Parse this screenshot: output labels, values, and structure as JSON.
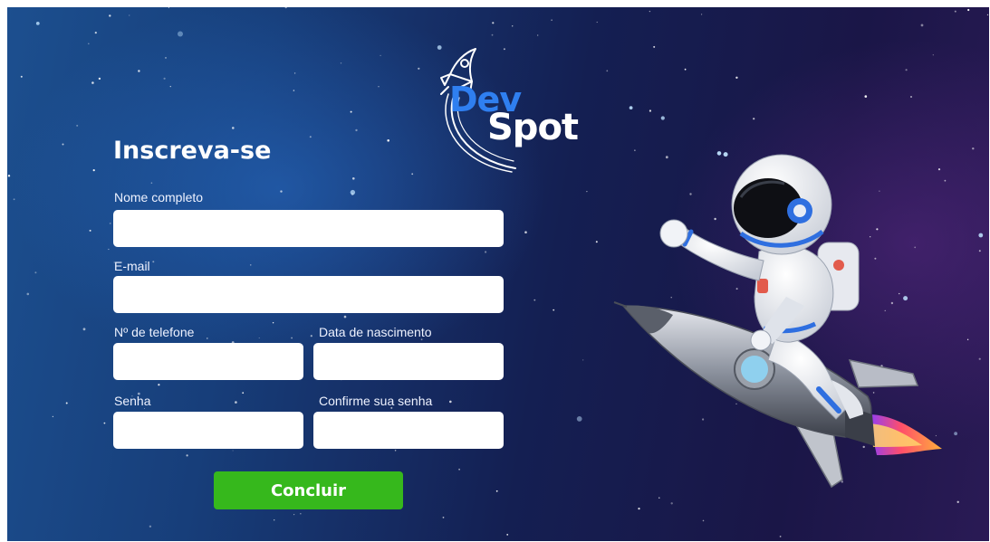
{
  "brand": {
    "name_part1": "Dev",
    "name_part2": "Spot",
    "logo_icon": "rocket-icon",
    "colors": {
      "accent_blue": "#2f7ff0",
      "text_white": "#ffffff"
    }
  },
  "form": {
    "title": "Inscreva-se",
    "fields": {
      "full_name": {
        "label": "Nome completo",
        "value": ""
      },
      "email": {
        "label": "E-mail",
        "value": ""
      },
      "phone": {
        "label": "Nº de telefone",
        "value": ""
      },
      "birth_date": {
        "label": "Data de nascimento",
        "value": ""
      },
      "password": {
        "label": "Senha",
        "value": ""
      },
      "confirm_password": {
        "label": "Confirme sua senha",
        "value": ""
      }
    },
    "submit_label": "Concluir",
    "submit_color": "#36b81c"
  },
  "illustration": {
    "icon": "astronaut-on-rocket-icon"
  }
}
